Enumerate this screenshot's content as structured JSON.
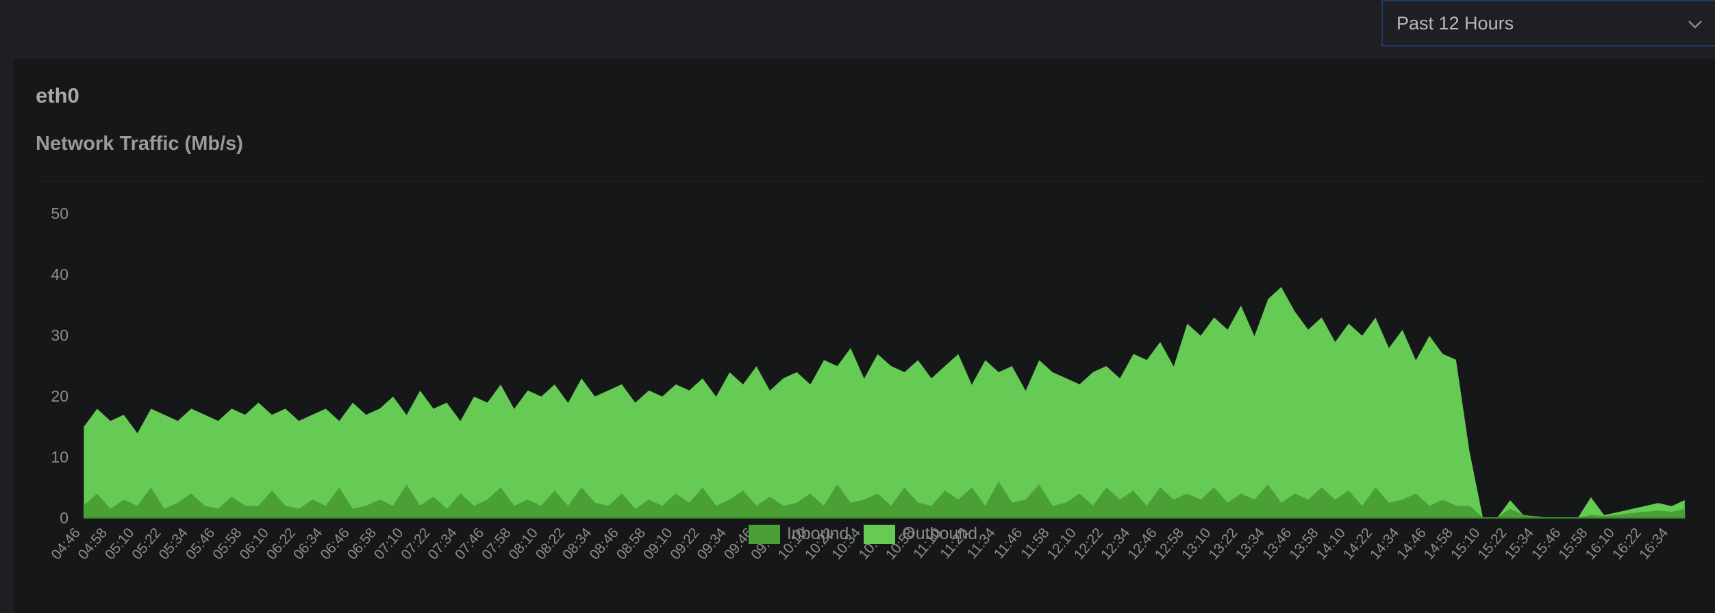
{
  "time_range": {
    "selected": "Past 12 Hours"
  },
  "panel": {
    "interface": "eth0",
    "title": "Network Traffic (Mb/s)"
  },
  "colors": {
    "inbound": "#4a9f35",
    "outbound": "#66cb55",
    "axis_text": "#8e8e8e"
  },
  "chart_data": {
    "type": "area",
    "title": "Network Traffic (Mb/s)",
    "xlabel": "",
    "ylabel": "Mb/s",
    "ylim": [
      0,
      50
    ],
    "yticks": [
      "0",
      "10",
      "20",
      "30",
      "40",
      "50"
    ],
    "start_time": "04:46",
    "interval_minutes": 6,
    "xticks": [
      "04:46",
      "04:58",
      "05:10",
      "05:22",
      "05:34",
      "05:46",
      "05:58",
      "06:10",
      "06:22",
      "06:34",
      "06:46",
      "06:58",
      "07:10",
      "07:22",
      "07:34",
      "07:46",
      "07:58",
      "08:10",
      "08:22",
      "08:34",
      "08:46",
      "08:58",
      "09:10",
      "09:22",
      "09:34",
      "09:46",
      "09:58",
      "10:10",
      "10:22",
      "10:34",
      "10:46",
      "10:58",
      "11:10",
      "11:22",
      "11:34",
      "11:46",
      "11:58",
      "12:10",
      "12:22",
      "12:34",
      "12:46",
      "12:58",
      "13:10",
      "13:22",
      "13:34",
      "13:46",
      "13:58",
      "14:10",
      "14:22",
      "14:34",
      "14:46",
      "14:58",
      "15:10",
      "15:22",
      "15:34",
      "15:46",
      "15:58",
      "16:10",
      "16:22",
      "16:34"
    ],
    "legend": [
      "Inbound",
      "Outbound"
    ],
    "legend_position": "bottom",
    "series": [
      {
        "name": "Outbound",
        "values": [
          15,
          18,
          16,
          17,
          14,
          18,
          17,
          16,
          18,
          17,
          16,
          18,
          17,
          19,
          17,
          18,
          16,
          17,
          18,
          16,
          19,
          17,
          18,
          20,
          17,
          21,
          18,
          19,
          16,
          20,
          19,
          22,
          18,
          21,
          20,
          22,
          19,
          23,
          20,
          21,
          22,
          19,
          21,
          20,
          22,
          21,
          23,
          20,
          24,
          22,
          25,
          21,
          23,
          24,
          22,
          26,
          25,
          28,
          23,
          27,
          25,
          24,
          26,
          23,
          25,
          27,
          22,
          26,
          24,
          25,
          21,
          26,
          24,
          23,
          22,
          24,
          25,
          23,
          27,
          26,
          29,
          25,
          32,
          30,
          33,
          31,
          35,
          30,
          36,
          38,
          34,
          31,
          33,
          29,
          32,
          30,
          33,
          28,
          31,
          26,
          30,
          27,
          26,
          11,
          0,
          0,
          3,
          0.5,
          0.3,
          0,
          0,
          0,
          3.5,
          0.5,
          1,
          1.5,
          2,
          2.5,
          2,
          3
        ]
      },
      {
        "name": "Inbound",
        "values": [
          2,
          4,
          1.5,
          3,
          2,
          5,
          1.5,
          2.5,
          4,
          2,
          1.5,
          3.5,
          2,
          2,
          4.5,
          2,
          1.5,
          3,
          2,
          5,
          1.5,
          2,
          3,
          2,
          5.5,
          2,
          3.5,
          1.5,
          4,
          2,
          3,
          5,
          2,
          3,
          2,
          4.5,
          2,
          5,
          2.5,
          2,
          4,
          1.5,
          3,
          2,
          4,
          2.5,
          5,
          2,
          3,
          4.5,
          2,
          3.5,
          2,
          2.5,
          4,
          2,
          5.5,
          2.5,
          3,
          4,
          2,
          5,
          2.5,
          2,
          4.5,
          3,
          5,
          2,
          6,
          2.5,
          3,
          5.5,
          2,
          2.5,
          4,
          2,
          5,
          3,
          4.5,
          2,
          5,
          3,
          4,
          3,
          5,
          2.5,
          4,
          3,
          5.5,
          2.5,
          4,
          3,
          5,
          3,
          4.5,
          2,
          5,
          2.5,
          3,
          4,
          2,
          3,
          2,
          2,
          0,
          0,
          1.5,
          0.5,
          0.2,
          0,
          0,
          0,
          0.5,
          0.3,
          0.5,
          0.8,
          1,
          1.2,
          1,
          1.5
        ]
      }
    ]
  }
}
